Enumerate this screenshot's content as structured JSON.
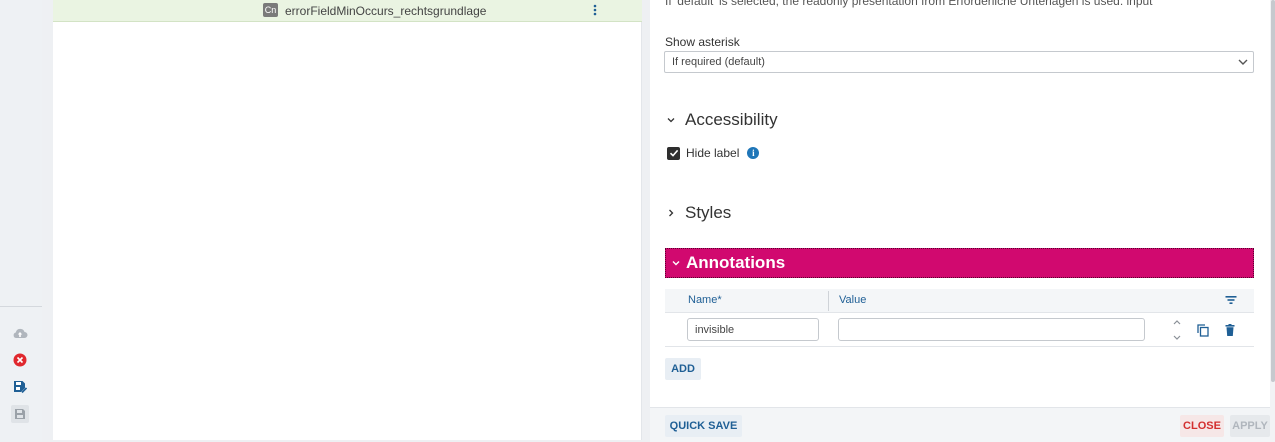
{
  "tree": {
    "node": {
      "badge": "Cn",
      "label": "errorFieldMinOccurs_rechtsgrundlage"
    }
  },
  "sidebar": {
    "icons": [
      "cloud-upload-icon",
      "error-circle-icon",
      "save-as-icon",
      "save-icon"
    ],
    "colors": {
      "error": "#e0282e",
      "save_as": "#1f5f95",
      "disabled": "#b0b6bd"
    }
  },
  "properties": {
    "info_text": "If 'default' is selected, the readonly presentation from Erforderliche Unterlagen is used: input",
    "show_asterisk": {
      "label": "Show asterisk",
      "value": "If required (default)"
    },
    "accessibility": {
      "title": "Accessibility",
      "hide_label": {
        "label": "Hide label",
        "checked": true
      }
    },
    "styles": {
      "title": "Styles"
    },
    "annotations": {
      "title": "Annotations",
      "accent": "#d1096f",
      "columns": {
        "name": "Name*",
        "value": "Value"
      },
      "rows": [
        {
          "name": "invisible",
          "value": ""
        }
      ],
      "add_label": "ADD"
    }
  },
  "footer": {
    "quick_save": "QUICK SAVE",
    "close": "CLOSE",
    "apply": "APPLY"
  }
}
